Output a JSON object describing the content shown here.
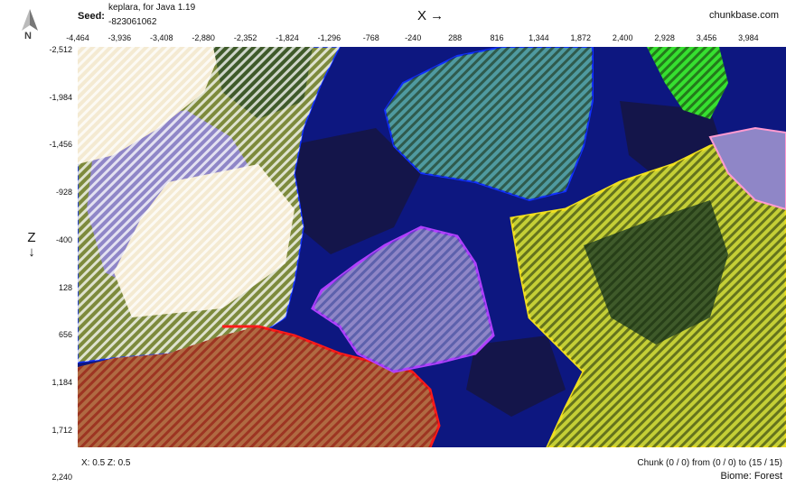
{
  "header": {
    "seed_label": "Seed:",
    "seed_line1": "keplara, for Java 1.19",
    "seed_line2": "-823061062",
    "x_axis_label": "X →",
    "brand": "chunkbase.com"
  },
  "compass": {
    "north_label": "N",
    "icon": "compass-arrow-icon"
  },
  "axis": {
    "z_label": "Z",
    "z_arrow": "↓",
    "x_ticks": [
      "-4,464",
      "-3,936",
      "-3,408",
      "-2,880",
      "-2,352",
      "-1,824",
      "-1,296",
      "-768",
      "-240",
      "288",
      "816",
      "1,344",
      "1,872",
      "2,400",
      "2,928",
      "3,456",
      "3,984"
    ],
    "z_ticks": [
      "-2,512",
      "-1,984",
      "-1,456",
      "-928",
      "-400",
      "128",
      "656",
      "1,184",
      "1,712",
      "2,240"
    ]
  },
  "footer": {
    "coords_text": "X: 0.5   Z: 0.5",
    "chunk_text": "Chunk (0 / 0) from (0 / 0) to (15 / 15)",
    "biome_text": "Biome: Forest"
  },
  "map": {
    "colors": {
      "deep_ocean": "#0d1780",
      "ocean": "#1a2ca8",
      "dark_zone": "#14154a",
      "lavender": "#8f86c7",
      "cream": "#f4ead2",
      "olive": "#7d8a3c",
      "dark_green": "#3f5a2a",
      "teal": "#4f9aa0",
      "yellow_green": "#c5cf36",
      "badlands": "#b06a42",
      "lime": "#36e030",
      "red_border": "#ff1a1a",
      "purple_border": "#b040ff",
      "yellow_border": "#f0e020",
      "blue_border": "#1030ff"
    }
  }
}
